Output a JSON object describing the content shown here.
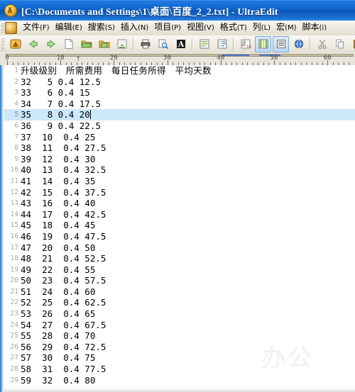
{
  "window": {
    "title": "[C:\\Documents and Settings\\1\\桌面\\百度_2_2.txt] - UltraEdit",
    "app_icon": "ultraedit-icon",
    "titlebar_color": "#0d5fc4"
  },
  "menubar": {
    "items": [
      {
        "label": "文件(F)"
      },
      {
        "label": "编辑(E)"
      },
      {
        "label": "搜索(S)"
      },
      {
        "label": "插入(N)"
      },
      {
        "label": "项目(P)"
      },
      {
        "label": "视图(V)"
      },
      {
        "label": "格式(T)"
      },
      {
        "label": "列(L)"
      },
      {
        "label": "宏(M)"
      },
      {
        "label": "脚本(i)"
      }
    ]
  },
  "toolbar": {
    "buttons": [
      {
        "icon": "ultraedit-home-icon",
        "selected": false
      },
      {
        "icon": "back-arrow-icon",
        "selected": false
      },
      {
        "icon": "forward-arrow-icon",
        "selected": false
      },
      {
        "icon": "new-file-icon",
        "selected": false
      },
      {
        "icon": "open-folder-icon",
        "selected": false
      },
      {
        "icon": "save-folder-icon",
        "selected": false
      },
      {
        "icon": "save-as-icon",
        "selected": false
      },
      {
        "icon": "print-icon",
        "selected": false
      },
      {
        "icon": "print-preview-icon",
        "selected": false
      },
      {
        "icon": "font-icon",
        "selected": false
      },
      {
        "icon": "word-wrap-icon",
        "selected": false
      },
      {
        "icon": "line-numbers-icon",
        "selected": false
      },
      {
        "icon": "hex-edit-icon",
        "selected": false
      },
      {
        "icon": "column-mode-icon",
        "selected": true
      },
      {
        "icon": "list-view-icon",
        "selected": true
      },
      {
        "icon": "browser-icon",
        "selected": false
      },
      {
        "icon": "cut-icon",
        "selected": false
      },
      {
        "icon": "copy-icon",
        "selected": false
      },
      {
        "icon": "paste-icon",
        "selected": false
      }
    ],
    "combo_value": ""
  },
  "ruler": {
    "labels": [
      "0",
      "10",
      "20",
      "30",
      "40",
      "50",
      "60"
    ],
    "tab_marker": "T"
  },
  "editor": {
    "cursor_line": 5,
    "highlighted_line": 5,
    "watermark": "办公",
    "lines": [
      {
        "num": "1",
        "text": "升级级别　所需费用　每日任务所得　平均天数",
        "header": true
      },
      {
        "num": "2",
        "text": "32   5 0.4 12.5"
      },
      {
        "num": "3",
        "text": "33   6 0.4 15"
      },
      {
        "num": "4",
        "text": "34   7 0.4 17.5"
      },
      {
        "num": "5",
        "text": "35   8 0.4 20"
      },
      {
        "num": "6",
        "text": "36   9 0.4 22.5"
      },
      {
        "num": "7",
        "text": "37  10  0.4 25"
      },
      {
        "num": "8",
        "text": "38  11  0.4 27.5"
      },
      {
        "num": "9",
        "text": "39  12  0.4 30"
      },
      {
        "num": "10",
        "text": "40  13  0.4 32.5"
      },
      {
        "num": "11",
        "text": "41  14  0.4 35"
      },
      {
        "num": "12",
        "text": "42  15  0.4 37.5"
      },
      {
        "num": "13",
        "text": "43  16  0.4 40"
      },
      {
        "num": "14",
        "text": "44  17  0.4 42.5"
      },
      {
        "num": "15",
        "text": "45  18  0.4 45"
      },
      {
        "num": "16",
        "text": "46  19  0.4 47.5"
      },
      {
        "num": "17",
        "text": "47  20  0.4 50"
      },
      {
        "num": "18",
        "text": "48  21  0.4 52.5"
      },
      {
        "num": "19",
        "text": "49  22  0.4 55"
      },
      {
        "num": "20",
        "text": "50  23  0.4 57.5"
      },
      {
        "num": "21",
        "text": "51  24  0.4 60"
      },
      {
        "num": "22",
        "text": "52  25  0.4 62.5"
      },
      {
        "num": "23",
        "text": "53  26  0.4 65"
      },
      {
        "num": "24",
        "text": "54  27  0.4 67.5"
      },
      {
        "num": "25",
        "text": "55  28  0.4 70"
      },
      {
        "num": "26",
        "text": "56  29  0.4 72.5"
      },
      {
        "num": "27",
        "text": "57  30  0.4 75"
      },
      {
        "num": "28",
        "text": "58  31  0.4 77.5"
      },
      {
        "num": "29",
        "text": "59  32  0.4 80"
      }
    ]
  }
}
